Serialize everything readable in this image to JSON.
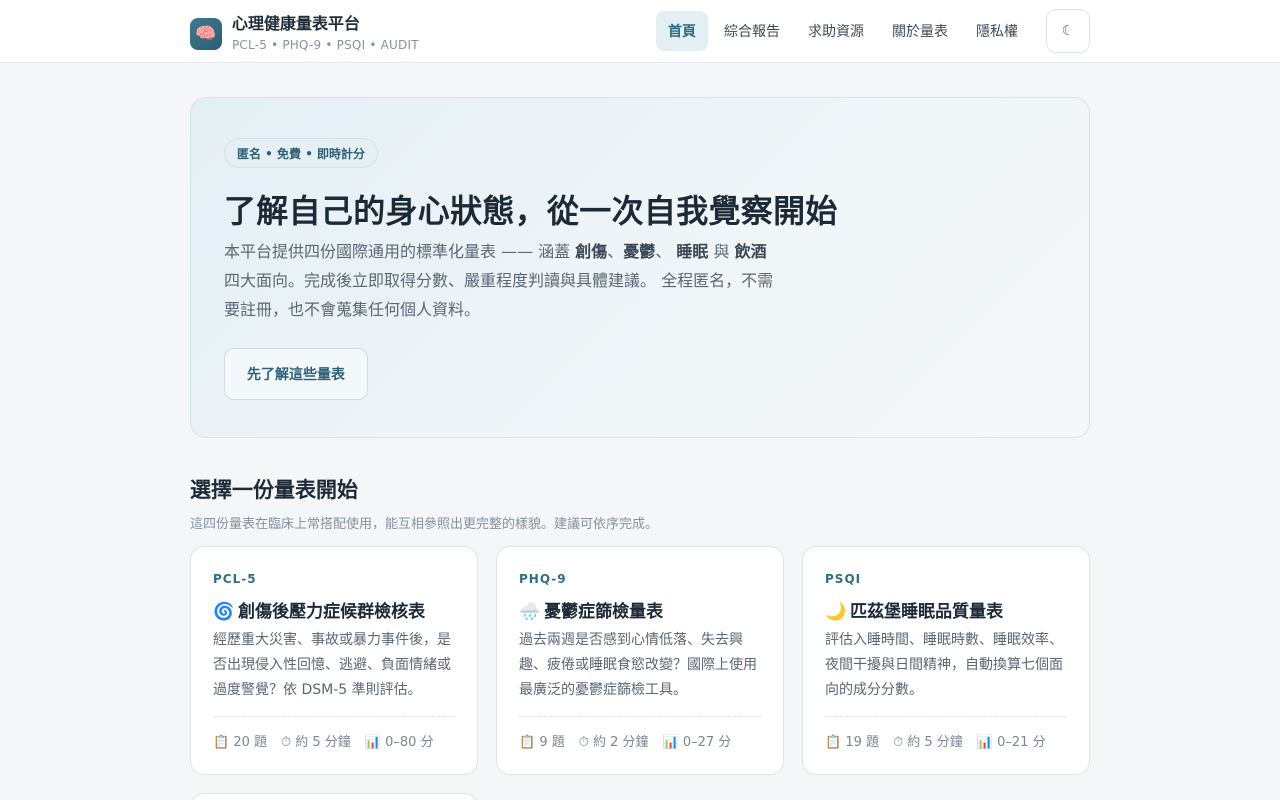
{
  "header": {
    "logo_icon": "brain-emoji",
    "logo_glyph": "🧠",
    "title": "心理健康量表平台",
    "subtitle": "PCL-5 • PHQ-9 • PSQI • AUDIT",
    "nav": [
      {
        "label": "首頁",
        "active": true
      },
      {
        "label": "綜合報告"
      },
      {
        "label": "求助資源"
      },
      {
        "label": "關於量表"
      },
      {
        "label": "隱私權"
      }
    ],
    "theme_toggle_icon": "moon-icon",
    "theme_toggle_glyph": "☾"
  },
  "hero": {
    "badge": "匿名 • 免費 • 即時計分",
    "title": "了解自己的身心狀態，從一次自我覺察開始",
    "desc_part1": "本平台提供四份國際通用的標準化量表 —— 涵蓋 ",
    "kw1": "創傷",
    "sep1": "、",
    "kw2": "憂鬱",
    "sep2": "、 ",
    "kw3": "睡眠",
    "sep3": " 與 ",
    "kw4": "飲酒",
    "desc_part2": " 四大面向。完成後立即取得分數、嚴重程度判讀與具體建議。 全程匿名，不需要註冊，也不會蒐集任何個人資料。",
    "button": "先了解這些量表"
  },
  "section": {
    "title": "選擇一份量表開始",
    "subtitle": "這四份量表在臨床上常搭配使用，能互相參照出更完整的樣貌。建議可依序完成。"
  },
  "cards": [
    {
      "code": "PCL-5",
      "emoji": "🌀",
      "title": "創傷後壓力症候群檢核表",
      "desc": "經歷重大災害、事故或暴力事件後，是否出現侵入性回憶、逃避、負面情緒或過度警覺？依 DSM-5 準則評估。",
      "items": "📋 20 題",
      "time": "⏱ 約 5 分鐘",
      "range": "📊 0–80 分"
    },
    {
      "code": "PHQ-9",
      "emoji": "🌧️",
      "title": "憂鬱症篩檢量表",
      "desc": "過去兩週是否感到心情低落、失去興趣、疲倦或睡眠食慾改變？國際上使用最廣泛的憂鬱症篩檢工具。",
      "items": "📋 9 題",
      "time": "⏱ 約 2 分鐘",
      "range": "📊 0–27 分"
    },
    {
      "code": "PSQI",
      "emoji": "🌙",
      "title": "匹茲堡睡眠品質量表",
      "desc": "評估入睡時間、睡眠時數、睡眠效率、夜間干擾與日間精神，自動換算七個面向的成分分數。",
      "items": "📋 19 題",
      "time": "⏱ 約 5 分鐘",
      "range": "📊 0–21 分"
    }
  ]
}
